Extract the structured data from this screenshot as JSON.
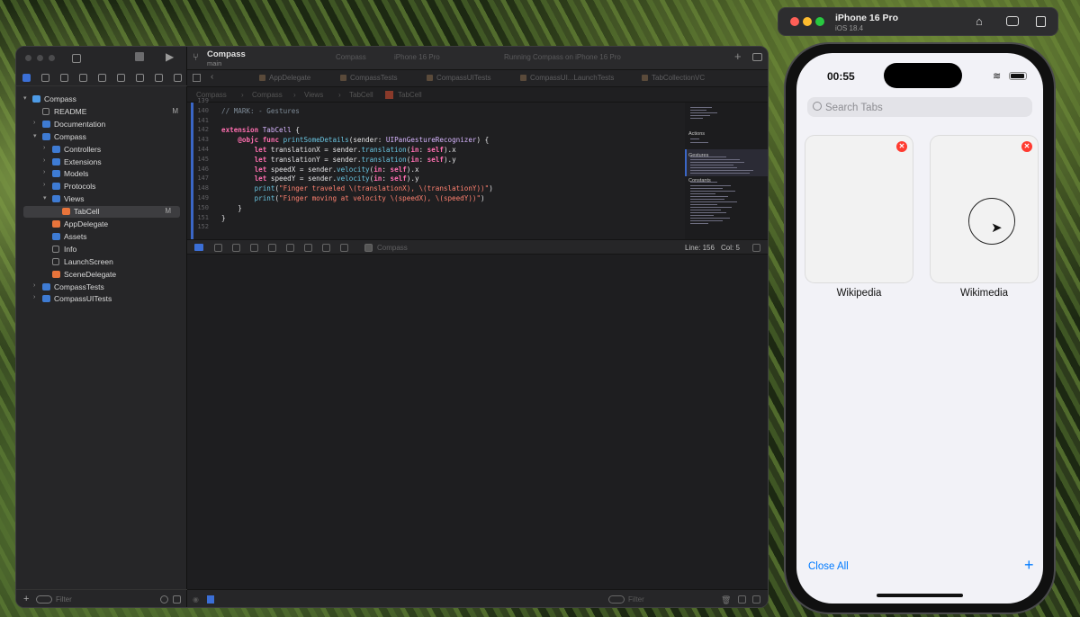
{
  "xcode": {
    "scheme": "Compass",
    "branch": "main",
    "destination": "iPhone 16 Pro",
    "status": "Running Compass on iPhone 16 Pro",
    "file_tabs": [
      "AppDelegate",
      "CompassTests",
      "CompassUITests",
      "CompassUI...LaunchTests",
      "TabCollectionVC"
    ],
    "jumpbar": [
      "Compass",
      "Compass",
      "Views",
      "TabCell",
      "TabCell"
    ],
    "navigator": {
      "items": [
        {
          "label": "Compass",
          "level": 0,
          "kind": "xc",
          "open": true
        },
        {
          "label": "README",
          "level": 1,
          "kind": "doc",
          "flag": "M"
        },
        {
          "label": "Documentation",
          "level": 1,
          "kind": "folder",
          "open": false
        },
        {
          "label": "Compass",
          "level": 1,
          "kind": "folder",
          "open": true
        },
        {
          "label": "Controllers",
          "level": 2,
          "kind": "folder",
          "open": false
        },
        {
          "label": "Extensions",
          "level": 2,
          "kind": "folder",
          "open": false
        },
        {
          "label": "Models",
          "level": 2,
          "kind": "folder",
          "open": false
        },
        {
          "label": "Protocols",
          "level": 2,
          "kind": "folder",
          "open": false
        },
        {
          "label": "Views",
          "level": 2,
          "kind": "folder",
          "open": true
        },
        {
          "label": "TabCell",
          "level": 3,
          "kind": "swift",
          "flag": "M",
          "selected": true
        },
        {
          "label": "AppDelegate",
          "level": 2,
          "kind": "swift"
        },
        {
          "label": "Assets",
          "level": 2,
          "kind": "folder"
        },
        {
          "label": "Info",
          "level": 2,
          "kind": "doc"
        },
        {
          "label": "LaunchScreen",
          "level": 2,
          "kind": "doc"
        },
        {
          "label": "SceneDelegate",
          "level": 2,
          "kind": "swift"
        },
        {
          "label": "CompassTests",
          "level": 1,
          "kind": "folder",
          "open": false
        },
        {
          "label": "CompassUITests",
          "level": 1,
          "kind": "folder",
          "open": false
        }
      ],
      "filter_placeholder": "Filter"
    },
    "code": {
      "line_numbers": [
        "139",
        "140",
        "141",
        "142",
        "143",
        "144",
        "145",
        "146",
        "147",
        "148",
        "149",
        "150",
        "151",
        "152"
      ],
      "lines": [
        "",
        "// MARK: - Gestures",
        "",
        "extension TabCell {",
        "    @objc func printSomeDetails(sender: UIPanGestureRecognizer) {",
        "        let translationX = sender.translation(in: self).x",
        "        let translationY = sender.translation(in: self).y",
        "        let speedX = sender.velocity(in: self).x",
        "        let speedY = sender.velocity(in: self).y",
        "        print(\"Finger traveled \\(translationX), \\(translationY))\")",
        "        print(\"Finger moving at velocity \\(speedX), \\(speedY))\")",
        "    }",
        "}",
        ""
      ]
    },
    "minimap_labels": [
      "Actions",
      "Gestures",
      "Constants"
    ],
    "debug": {
      "process": "Compass",
      "line": "Line: 156",
      "col": "Col: 5"
    },
    "console_filter_placeholder": "Filter"
  },
  "simulator": {
    "device": "iPhone 16 Pro",
    "os": "iOS 18.4",
    "time": "00:55",
    "search_placeholder": "Search Tabs",
    "tabs": [
      "Wikipedia",
      "Wikimedia"
    ],
    "close_all": "Close All",
    "add_symbol": "+"
  }
}
